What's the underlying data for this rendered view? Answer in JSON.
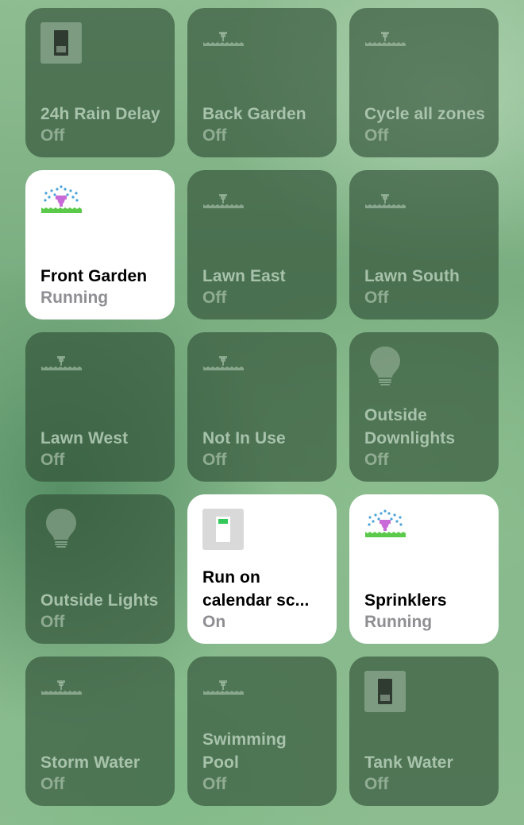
{
  "accessories": [
    {
      "name": "24h Rain Delay",
      "status": "Off",
      "icon": "switch-icon"
    },
    {
      "name": "Back Garden",
      "status": "Off",
      "icon": "sprinkler-icon"
    },
    {
      "name": "Cycle all zones",
      "status": "Off",
      "icon": "sprinkler-icon"
    },
    {
      "name": "Front Garden",
      "status": "Running",
      "icon": "sprinkler-running-icon"
    },
    {
      "name": "Lawn East",
      "status": "Off",
      "icon": "sprinkler-icon"
    },
    {
      "name": "Lawn South",
      "status": "Off",
      "icon": "sprinkler-icon"
    },
    {
      "name": "Lawn West",
      "status": "Off",
      "icon": "sprinkler-icon"
    },
    {
      "name": "Not In Use",
      "status": "Off",
      "icon": "sprinkler-icon"
    },
    {
      "name": "Outside Downlights",
      "status": "Off",
      "icon": "lightbulb-icon"
    },
    {
      "name": "Outside Lights",
      "status": "Off",
      "icon": "lightbulb-icon"
    },
    {
      "name": "Run on calendar sc...",
      "status": "On",
      "icon": "switch-on-icon"
    },
    {
      "name": "Sprinklers",
      "status": "Running",
      "icon": "sprinkler-running-icon"
    },
    {
      "name": "Storm Water",
      "status": "Off",
      "icon": "sprinkler-icon"
    },
    {
      "name": "Swimming Pool",
      "status": "Off",
      "icon": "sprinkler-icon"
    },
    {
      "name": "Tank Water",
      "status": "Off",
      "icon": "switch-icon"
    }
  ],
  "colors": {
    "tile_off": "#2c4a32",
    "tile_on": "#ffffff",
    "switch_on_accent": "#34c759",
    "sprinkler_head": "#c86ad8",
    "water_drops": "#4aa3d8",
    "grass": "#5bc94a"
  }
}
